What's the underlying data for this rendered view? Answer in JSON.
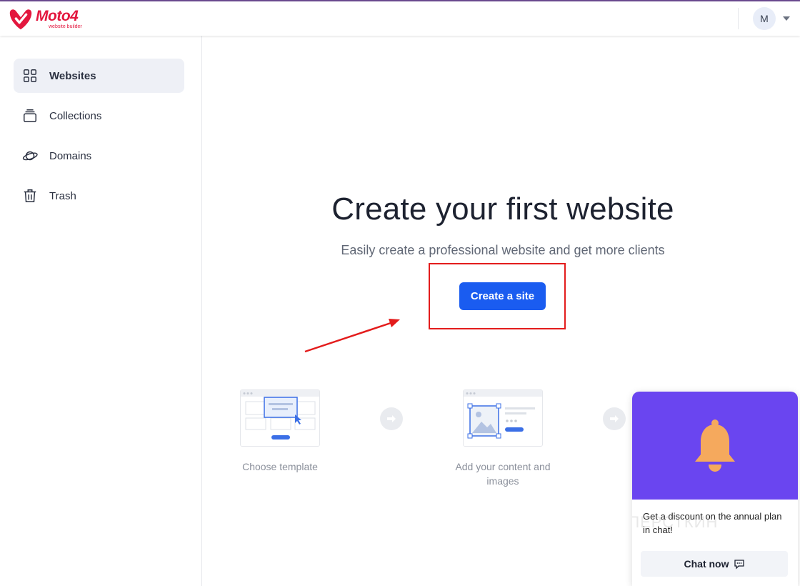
{
  "header": {
    "logo_name": "Moto4",
    "logo_sub": "website builder",
    "avatar_initial": "M"
  },
  "sidebar": {
    "items": [
      {
        "label": "Websites",
        "icon": "grid-icon",
        "active": true
      },
      {
        "label": "Collections",
        "icon": "stack-icon",
        "active": false
      },
      {
        "label": "Domains",
        "icon": "planet-icon",
        "active": false
      },
      {
        "label": "Trash",
        "icon": "trash-icon",
        "active": false
      }
    ]
  },
  "main": {
    "title": "Create your first website",
    "subtitle": "Easily create a professional website and get more clients",
    "cta_label": "Create a site",
    "steps": [
      {
        "caption": "Choose template"
      },
      {
        "caption": "Add your content and images"
      }
    ]
  },
  "popup": {
    "message": "Get a discount on the annual plan in chat!",
    "button_label": "Chat now",
    "watermark": "НАПЁРСТКИН"
  },
  "colors": {
    "brand": "#e3173e",
    "primary": "#1a5cf0",
    "popup_bg": "#6a45f0",
    "bell": "#f5a95d",
    "annotation": "#e31c1c"
  }
}
